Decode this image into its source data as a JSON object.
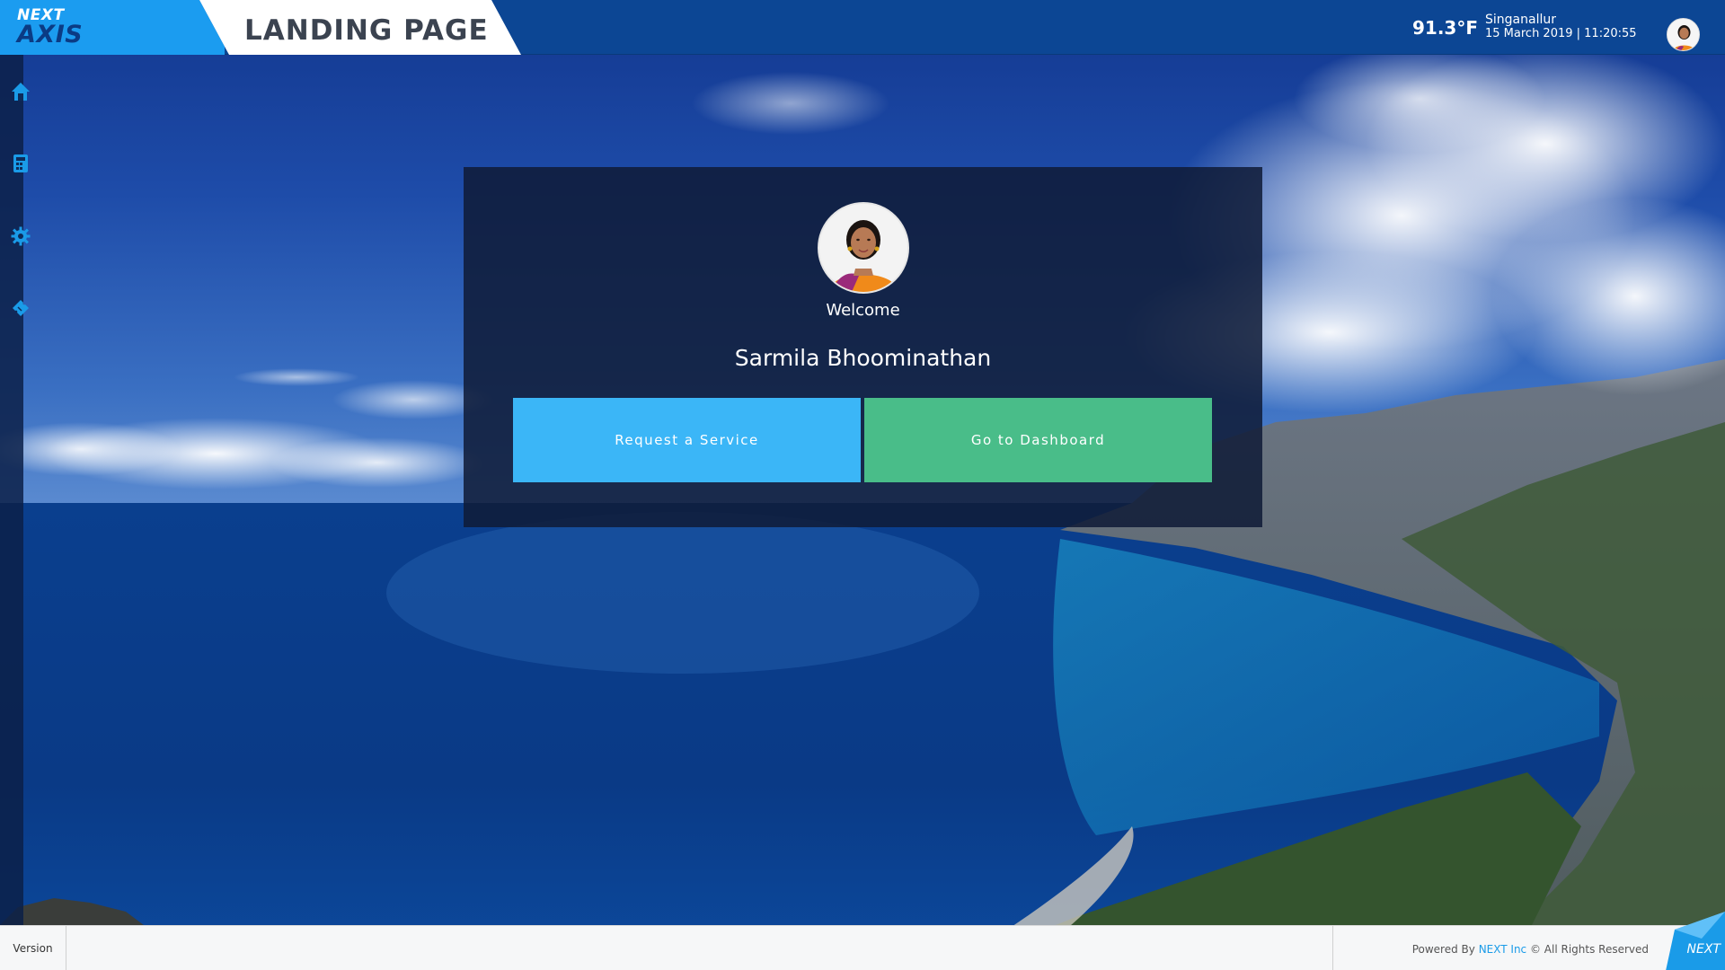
{
  "header": {
    "logo_top": "NEXT",
    "logo_bottom": "AXIS",
    "page_title": "LANDING PAGE",
    "temperature": "91.3°F",
    "location": "Singanallur",
    "datetime": "15 March 2019 | 11:20:55"
  },
  "sidebar": {
    "items": [
      {
        "icon": "home-icon"
      },
      {
        "icon": "calculator-icon"
      },
      {
        "icon": "gear-icon"
      },
      {
        "icon": "ticket-icon"
      }
    ]
  },
  "card": {
    "welcome": "Welcome",
    "user_name": "Sarmila Bhoominathan",
    "request_button": "Request a Service",
    "dashboard_button": "Go to Dashboard"
  },
  "footer": {
    "version": "Version",
    "powered_prefix": "Powered By ",
    "powered_brand": "NEXT Inc",
    "powered_suffix": " © All Rights Reserved",
    "corner_logo": "NEXT"
  },
  "colors": {
    "header_bg": "#0c4694",
    "logo_bg": "#1b9cf0",
    "request_button": "#3bb6f7",
    "dashboard_button": "#49bd89",
    "brand_link": "#1a9be8"
  }
}
